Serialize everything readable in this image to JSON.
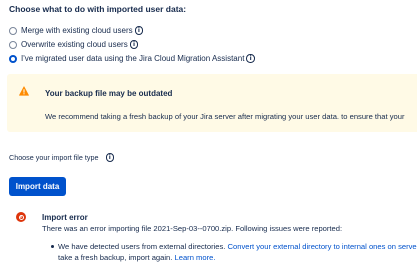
{
  "heading": "Choose what to do with imported user data:",
  "options": [
    {
      "label": "Merge with existing cloud users",
      "checked": false
    },
    {
      "label": "Overwrite existing cloud users",
      "checked": false
    },
    {
      "label": "I've migrated user data using the Jira Cloud Migration Assistant",
      "checked": true
    }
  ],
  "warning": {
    "title": "Your backup file may be outdated",
    "text": "We recommend taking a fresh backup of your Jira server after migrating your user data. to ensure that your"
  },
  "file_type": {
    "label": "Choose your import file type"
  },
  "import_button": "Import data",
  "error": {
    "title": "Import error",
    "text": "There was an error importing file 2021-Sep-03--0700.zip. Following issues were reported:",
    "bullet": {
      "prefix": "We have detected users from external directories. ",
      "link1": "Convert your external directory to internal ones on server",
      "middle": ", take a fresh backup, import again. ",
      "link2": "Learn more."
    }
  },
  "colors": {
    "primary": "#0052CC",
    "warning_bg": "#FFFAE6",
    "warning_icon": "#FF8B00",
    "error": "#DE350B"
  }
}
